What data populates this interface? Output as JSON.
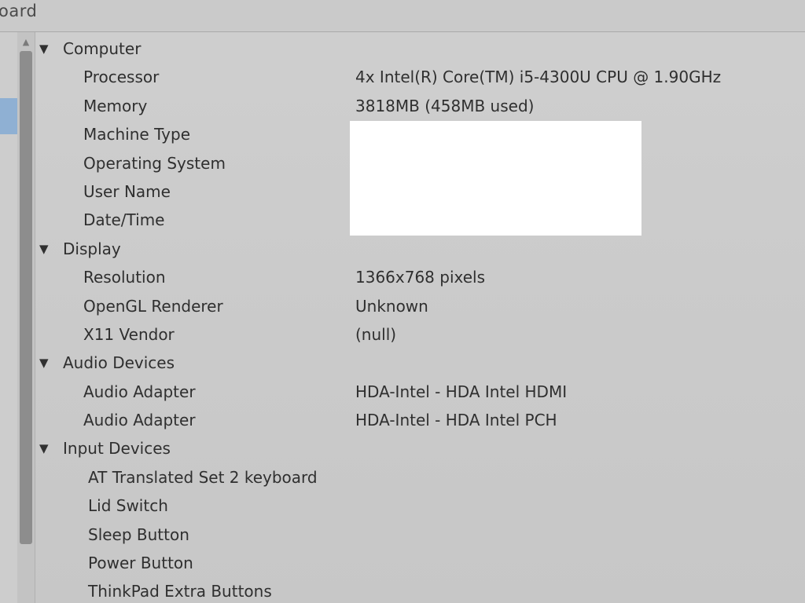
{
  "window": {
    "title_fragment": "oard"
  },
  "sections": [
    {
      "label": "Computer",
      "rows": [
        {
          "key": "Processor",
          "value": "4x Intel(R) Core(TM) i5-4300U CPU @ 1.90GHz"
        },
        {
          "key": "Memory",
          "value": "3818MB (458MB used)"
        },
        {
          "key": "Machine Type",
          "value": ""
        },
        {
          "key": "Operating System",
          "value": ""
        },
        {
          "key": "User Name",
          "value": ""
        },
        {
          "key": "Date/Time",
          "value": ""
        }
      ]
    },
    {
      "label": "Display",
      "rows": [
        {
          "key": "Resolution",
          "value": "1366x768 pixels"
        },
        {
          "key": "OpenGL Renderer",
          "value": "Unknown"
        },
        {
          "key": "X11 Vendor",
          "value": "(null)"
        }
      ]
    },
    {
      "label": "Audio Devices",
      "rows": [
        {
          "key": "Audio Adapter",
          "value": "HDA-Intel - HDA Intel HDMI"
        },
        {
          "key": "Audio Adapter",
          "value": "HDA-Intel - HDA Intel PCH"
        }
      ]
    },
    {
      "label": "Input Devices",
      "rows": [
        {
          "key": "AT Translated Set 2 keyboard",
          "value": ""
        },
        {
          "key": "Lid Switch",
          "value": ""
        },
        {
          "key": "Sleep Button",
          "value": ""
        },
        {
          "key": "Power Button",
          "value": ""
        },
        {
          "key": "ThinkPad Extra Buttons",
          "value": ""
        }
      ]
    }
  ],
  "icons": {
    "expand": "▼",
    "scroll_up": "▲"
  },
  "colors": {
    "background": "#cbcbcb",
    "text": "#2f2f2f",
    "selection": "#8fb0d3",
    "scroll_thumb": "#8d8d8d",
    "redaction": "#ffffff"
  }
}
